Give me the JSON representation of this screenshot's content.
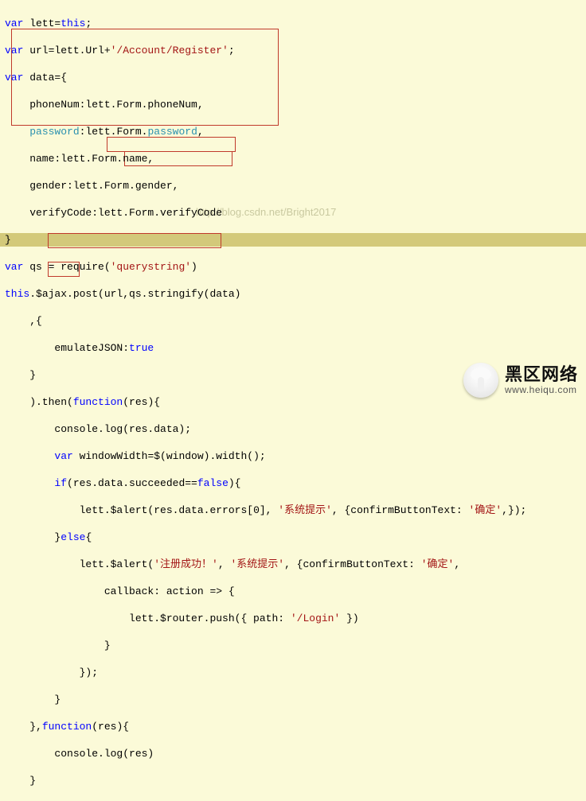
{
  "code": {
    "l01": "var lett=this;",
    "l02": "var url=lett.Url+'/Account/Register';",
    "l03": "var data={",
    "l04": "    phoneNum:lett.Form.phoneNum,",
    "l05": "    password:lett.Form.password,",
    "l06": "    name:lett.Form.name,",
    "l07": "    gender:lett.Form.gender,",
    "l08": "    verifyCode:lett.Form.verifyCode",
    "l09": "}",
    "l10": "var qs = require('querystring')",
    "l11": "this.$ajax.post(url,qs.stringify(data)",
    "l12": "    ,{",
    "l13": "        emulateJSON:true",
    "l14": "    }",
    "l15": "    ).then(function(res){",
    "l16": "        console.log(res.data);",
    "l17": "        var windowWidth=$(window).width();",
    "l18": "        if(res.data.succeeded==false){",
    "l19": "            lett.$alert(res.data.errors[0], '系统提示', {confirmButtonText: '确定',});",
    "l20": "        }else{",
    "l21": "            lett.$alert('注册成功！', '系统提示', {confirmButtonText: '确定',",
    "l22": "                callback: action => {",
    "l23": "                    lett.$router.push({ path: '/Login' })",
    "l24": "                }",
    "l25": "            });",
    "l26": "        }",
    "l27": "    },function(res){",
    "l28": "        console.log(res)",
    "l29": "    }"
  },
  "watermark": {
    "url": "http://blog.csdn.net/Bright2017"
  },
  "logo": {
    "cn": "黑区网络",
    "en": "www.heiqu.com"
  }
}
